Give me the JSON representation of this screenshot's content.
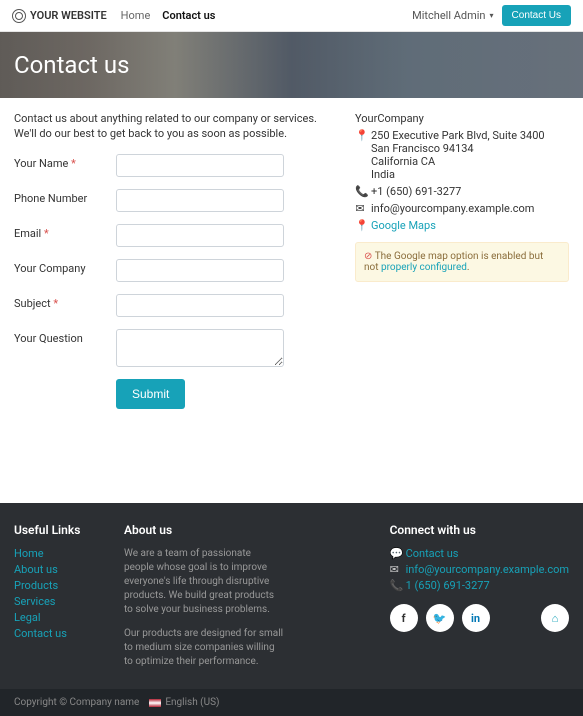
{
  "header": {
    "logo_text": "YOUR WEBSITE",
    "nav": {
      "home": "Home",
      "contact": "Contact us"
    },
    "admin": "Mitchell Admin",
    "contact_btn": "Contact Us"
  },
  "hero": {
    "title": "Contact us"
  },
  "intro": {
    "line1": "Contact us about anything related to our company or services.",
    "line2": "We'll do our best to get back to you as soon as possible."
  },
  "form": {
    "name_label": "Your Name",
    "phone_label": "Phone Number",
    "email_label": "Email",
    "company_label": "Your Company",
    "subject_label": "Subject",
    "question_label": "Your Question",
    "submit": "Submit",
    "req": "*"
  },
  "company": {
    "name": "YourCompany",
    "address_line1": "250 Executive Park Blvd, Suite 3400",
    "address_line2": "San Francisco 94134",
    "address_line3": "California CA",
    "address_line4": "India",
    "phone": "+1 (650) 691-3277",
    "email": "info@yourcompany.example.com",
    "maps": "Google Maps"
  },
  "warning": {
    "text1": "The Google map option is enabled but not ",
    "text2": "properly configured",
    "text3": "."
  },
  "footer": {
    "useful_title": "Useful Links",
    "useful": [
      "Home",
      "About us",
      "Products",
      "Services",
      "Legal",
      "Contact us"
    ],
    "about_title": "About us",
    "about_p1": "We are a team of passionate people whose goal is to improve everyone's life through disruptive products. We build great products to solve your business problems.",
    "about_p2": "Our products are designed for small to medium size companies willing to optimize their performance.",
    "connect_title": "Connect with us",
    "connect_contact": "Contact us",
    "connect_email": "info@yourcompany.example.com",
    "connect_phone": "1 (650) 691-3277"
  },
  "copyright": {
    "text": "Copyright © Company name",
    "lang": "English (US)"
  }
}
